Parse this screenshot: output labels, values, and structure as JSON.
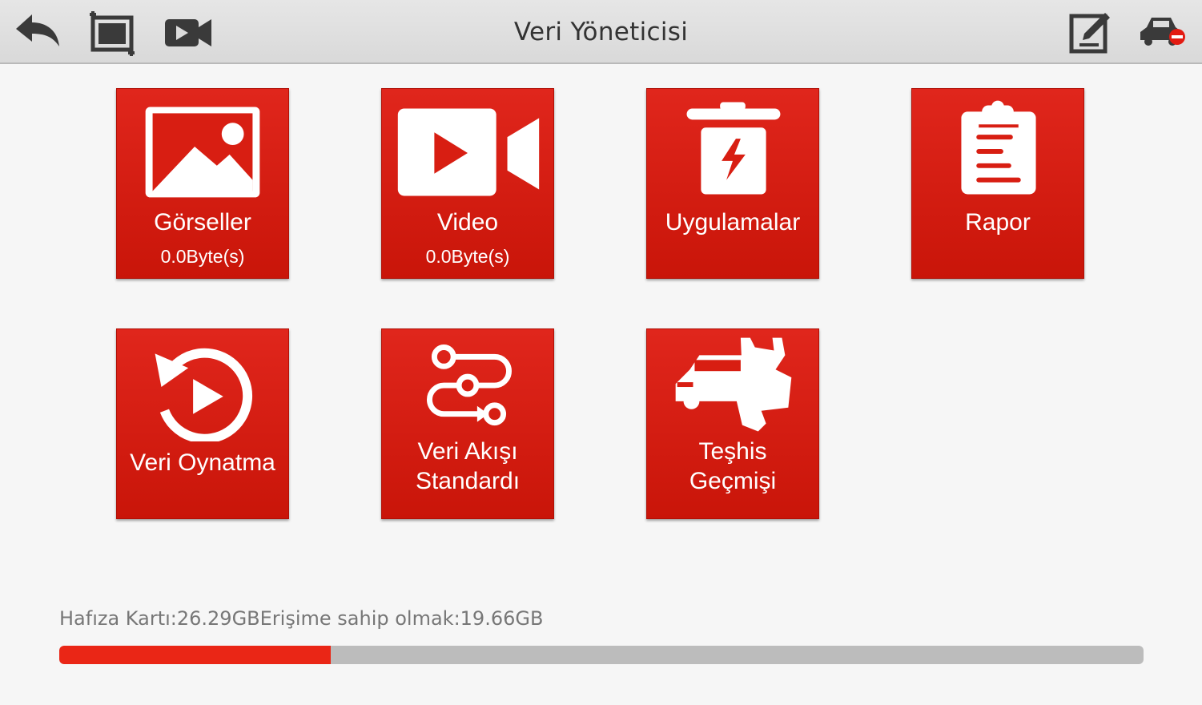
{
  "header": {
    "title": "Veri Yöneticisi"
  },
  "tiles": [
    {
      "id": "images",
      "label": "Görseller",
      "sub": "0.0Byte(s)",
      "icon": "image-icon"
    },
    {
      "id": "video",
      "label": "Video",
      "sub": "0.0Byte(s)",
      "icon": "video-camera-icon"
    },
    {
      "id": "apps",
      "label": "Uygulamalar",
      "icon": "trash-lightning-icon"
    },
    {
      "id": "report",
      "label": "Rapor",
      "icon": "clipboard-icon"
    },
    {
      "id": "replay",
      "label": "Veri Oynatma",
      "icon": "replay-icon"
    },
    {
      "id": "datastream",
      "label": "Veri Akışı Standardı",
      "line1": "Veri Akışı",
      "line2": "Standardı",
      "icon": "flow-path-icon"
    },
    {
      "id": "history",
      "label": "Teşhis Geçmişi",
      "line1": "Teşhis",
      "line2": "Geçmişi",
      "icon": "car-wrench-icon"
    }
  ],
  "storage": {
    "card_label": "Hafıza Kartı:26.29GB",
    "available_label": "Erişime sahip olmak:19.66GB",
    "used_fraction": 0.25
  },
  "colors": {
    "tile": "#d81e12",
    "bar_fill": "#ea2616",
    "bar_track": "#bcbcbc"
  }
}
